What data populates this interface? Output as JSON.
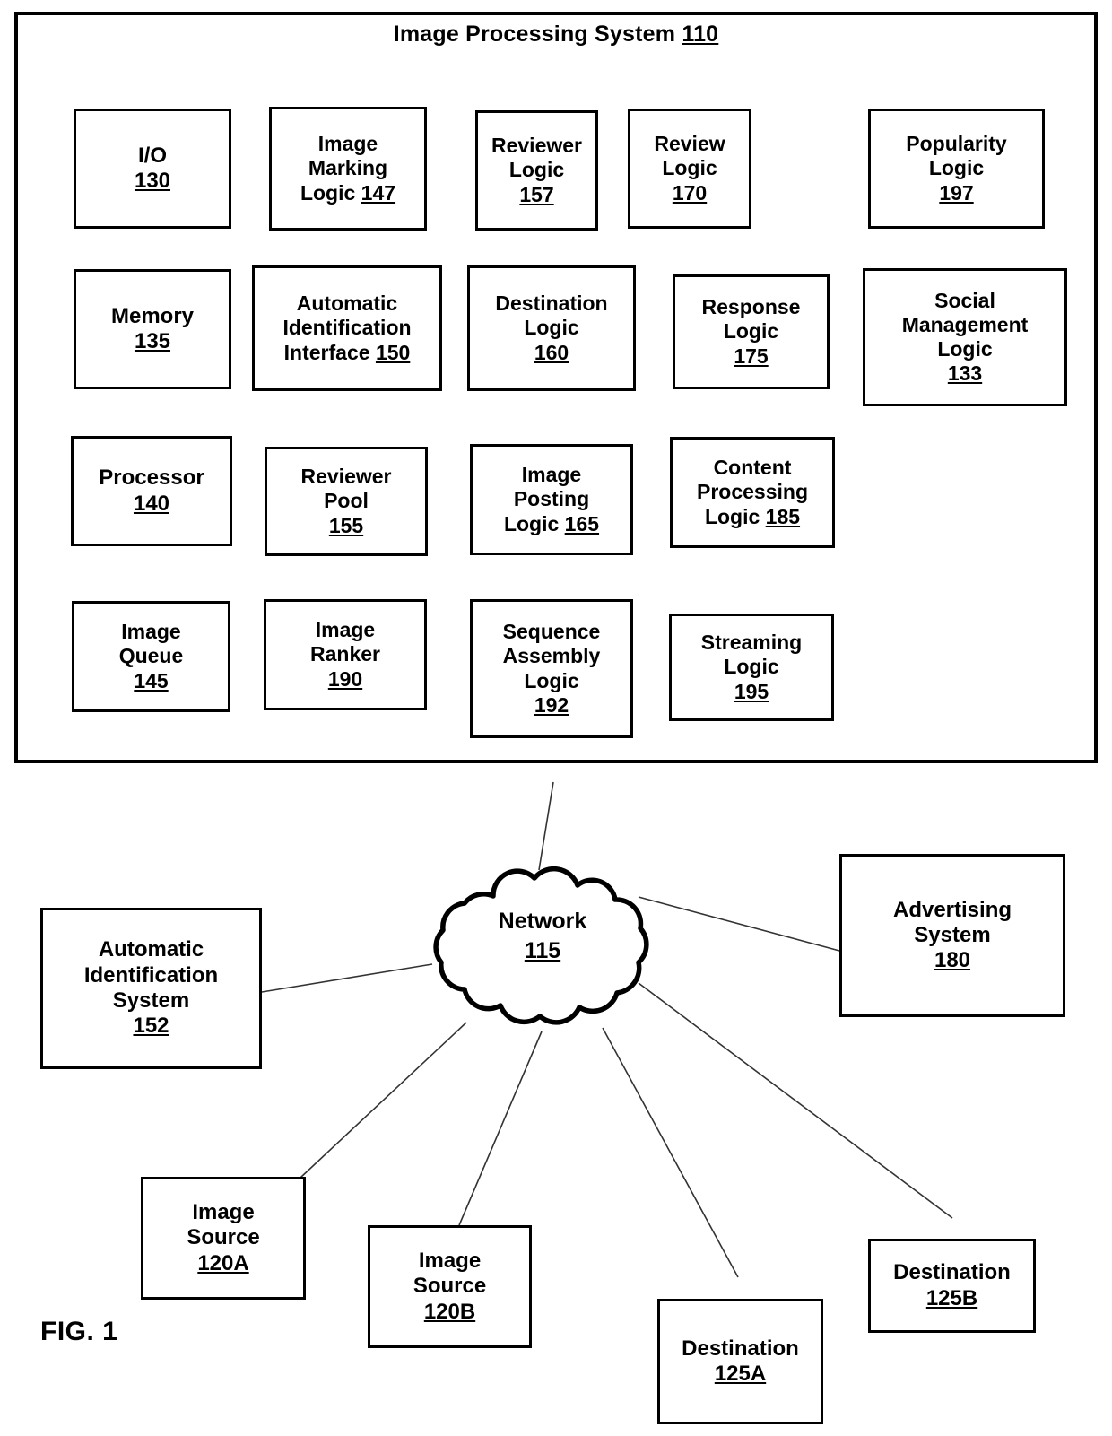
{
  "figure": {
    "caption": "FIG. 1",
    "title_text": "Image Processing System",
    "title_ref": "110"
  },
  "system": {
    "modules": [
      {
        "lines": [
          "I/O"
        ],
        "ref": "130",
        "ref_inline": false
      },
      {
        "lines": [
          "Image",
          "Marking",
          "Logic"
        ],
        "ref": "147",
        "ref_inline": true
      },
      {
        "lines": [
          "Reviewer",
          "Logic"
        ],
        "ref": "157",
        "ref_inline": false
      },
      {
        "lines": [
          "Review",
          "Logic"
        ],
        "ref": "170",
        "ref_inline": false
      },
      {
        "lines": [
          "Popularity",
          "Logic"
        ],
        "ref": "197",
        "ref_inline": false
      },
      {
        "lines": [
          "Memory"
        ],
        "ref": "135",
        "ref_inline": false
      },
      {
        "lines": [
          "Automatic",
          "Identification",
          "Interface"
        ],
        "ref": "150",
        "ref_inline": true
      },
      {
        "lines": [
          "Destination",
          "Logic"
        ],
        "ref": "160",
        "ref_inline": false
      },
      {
        "lines": [
          "Response",
          "Logic"
        ],
        "ref": "175",
        "ref_inline": false
      },
      {
        "lines": [
          "Social",
          "Management",
          "Logic"
        ],
        "ref": "133",
        "ref_inline": false
      },
      {
        "lines": [
          "Processor"
        ],
        "ref": "140",
        "ref_inline": false
      },
      {
        "lines": [
          "Reviewer",
          "Pool"
        ],
        "ref": "155",
        "ref_inline": false
      },
      {
        "lines": [
          "Image",
          "Posting",
          "Logic"
        ],
        "ref": "165",
        "ref_inline": true
      },
      {
        "lines": [
          "Content",
          "Processing",
          "Logic"
        ],
        "ref": "185",
        "ref_inline": true
      },
      {
        "lines": [
          "Image",
          "Queue"
        ],
        "ref": "145",
        "ref_inline": false
      },
      {
        "lines": [
          "Image",
          "Ranker"
        ],
        "ref": "190",
        "ref_inline": false
      },
      {
        "lines": [
          "Sequence",
          "Assembly",
          "Logic"
        ],
        "ref": "192",
        "ref_inline": false
      },
      {
        "lines": [
          "Streaming",
          "Logic"
        ],
        "ref": "195",
        "ref_inline": false
      }
    ]
  },
  "network": {
    "label": "Network",
    "ref": "115"
  },
  "peripherals": [
    {
      "lines": [
        "Automatic",
        "Identification",
        "System"
      ],
      "ref": "152",
      "ref_inline": false
    },
    {
      "lines": [
        "Advertising",
        "System"
      ],
      "ref": "180",
      "ref_inline": false
    },
    {
      "lines": [
        "Image",
        "Source"
      ],
      "ref": "120A",
      "ref_inline": false
    },
    {
      "lines": [
        "Image",
        "Source"
      ],
      "ref": "120B",
      "ref_inline": false
    },
    {
      "lines": [
        "Destination"
      ],
      "ref": "125A",
      "ref_inline": false
    },
    {
      "lines": [
        "Destination"
      ],
      "ref": "125B",
      "ref_inline": false
    }
  ],
  "colors": {
    "stroke": "#000000",
    "background": "#ffffff",
    "connector": "#333333"
  }
}
